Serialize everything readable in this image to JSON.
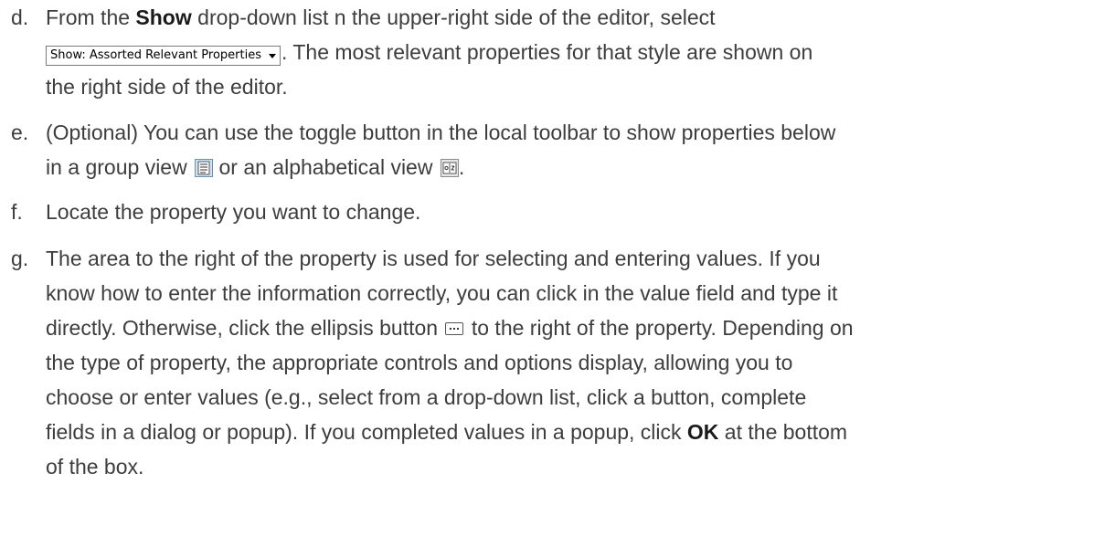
{
  "steps": [
    {
      "marker": "d.",
      "line1_pre": "From the ",
      "line1_kw": "Show",
      "line1_post": " drop-down list  n the upper-right side of the editor, select",
      "dropdown_label": "Show: Assorted Relevant Properties",
      "line2_post": ". The most relevant properties for that style are shown on",
      "line3": "the right side of the editor."
    },
    {
      "marker": "e.",
      "line1": "(Optional) You can use the toggle button in the local toolbar to show properties below",
      "line2_pre": "in a group view ",
      "line2_mid": " or an alphabetical view ",
      "line2_end": "."
    },
    {
      "marker": "f.",
      "line1": "Locate the property you want to change."
    },
    {
      "marker": "g.",
      "line1": "The area to the right of the property is used for selecting and entering values. If you",
      "line2": "know how to enter the information correctly, you can click in the value field and type it",
      "line3_pre": "directly. Otherwise, click the ellipsis button ",
      "line3_post": " to the right of the property. Depending on",
      "line4": "the type of property, the appropriate controls and options display, allowing you to",
      "line5": "choose or enter values (e.g., select from a drop-down list, click a button, complete",
      "line6_pre": "fields in a dialog or popup). If you completed values in a popup, click ",
      "line6_kw": "OK",
      "line6_post": " at the bottom",
      "line7": "of the box."
    }
  ],
  "icons": {
    "group_view": "group-view-icon",
    "alphabetical_view": "alphabetical-view-icon",
    "ellipsis": "ellipsis-button-icon",
    "dropdown_arrow": "chevron-down-icon"
  },
  "colors": {
    "text": "#3d3d3d",
    "keyword": "#1a1a1a"
  }
}
